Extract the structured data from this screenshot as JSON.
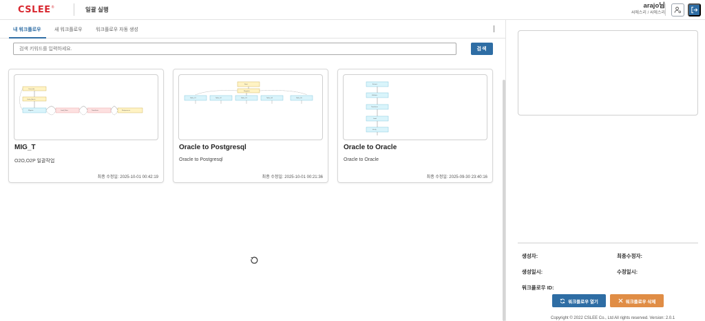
{
  "header": {
    "logo_text": "CSLEE",
    "logo_mark": "®",
    "page_title": "일괄 실행",
    "user_name": "arajo님",
    "user_org": "씨에스리 / 씨에스리",
    "settings_icon": "user-settings-icon",
    "logout_icon": "logout-icon"
  },
  "tabs": [
    {
      "label": "내 워크플로우",
      "active": true
    },
    {
      "label": "새 워크플로우",
      "active": false
    },
    {
      "label": "워크플로우 자동 생성",
      "active": false
    }
  ],
  "search": {
    "placeholder": "검색 키워드를 입력하세요.",
    "value": "",
    "button_label": "검색"
  },
  "cards": [
    {
      "title": "MIG_T",
      "description": "O2O,O2P 일괄작업",
      "modified": "최종 수정일: 2025-10-01 00:42:19"
    },
    {
      "title": "Oracle to Postgresql",
      "description": "Oracle to Postgresql",
      "modified": "최종 수정일: 2025-10-01 00:21:36"
    },
    {
      "title": "Oracle to Oracle",
      "description": "Oracle to Oracle",
      "modified": "최종 수정일: 2025-09-30 23:40:16"
    }
  ],
  "refresh_icon": "refresh-icon",
  "details": {
    "creator_label": "생성자:",
    "modifier_label": "최종수정자:",
    "created_label": "생성일시:",
    "modified_label": "수정일시:",
    "workflow_id_label": "워크플로우 ID:"
  },
  "actions": {
    "open_label": "워크플로우 열기",
    "delete_label": "워크플로우 삭제"
  },
  "footer": {
    "text": "Copyright © 2022 CSLEE Co., Ltd All rights reserved.   Version: 2.0.1"
  },
  "colors": {
    "brand_red": "#d8262e",
    "primary_blue": "#2e6da4",
    "delete_orange": "#e08d45",
    "node_yellow": "#fff3c4",
    "node_cyan": "#d9f4fb",
    "node_pink": "#fde0e0"
  }
}
